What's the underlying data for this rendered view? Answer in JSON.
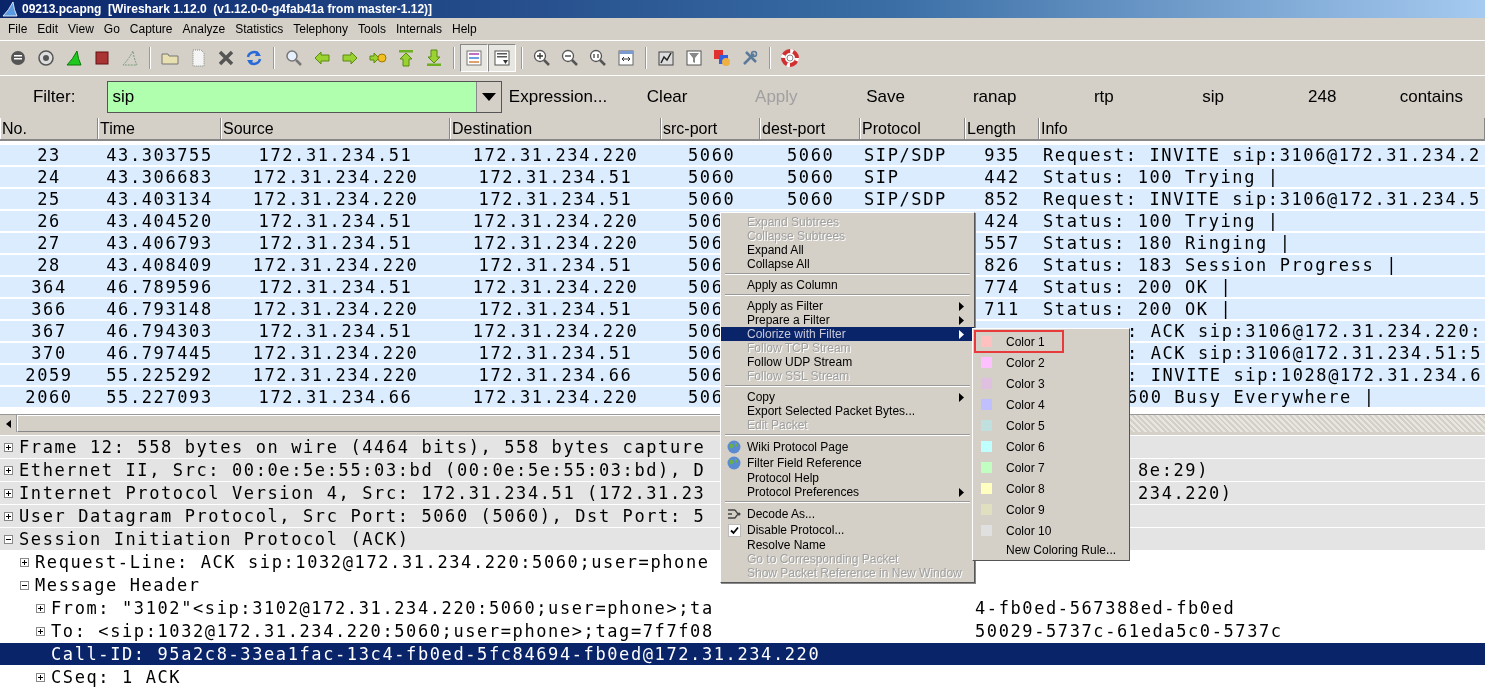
{
  "window": {
    "title": "09213.pcapng  [Wireshark 1.12.0  (v1.12.0-0-g4fab41a from master-1.12)]"
  },
  "menu_bar": [
    "File",
    "Edit",
    "View",
    "Go",
    "Capture",
    "Analyze",
    "Statistics",
    "Telephony",
    "Tools",
    "Internals",
    "Help"
  ],
  "toolbar": {
    "toggle_buttons": [
      {
        "pressed": true
      },
      {
        "pressed": true
      }
    ]
  },
  "filter_bar": {
    "label": "Filter:",
    "value": "sip",
    "buttons": [
      {
        "label": "Expression...",
        "disabled": false
      },
      {
        "label": "Clear",
        "disabled": false
      },
      {
        "label": "Apply",
        "disabled": true
      },
      {
        "label": "Save",
        "disabled": false
      },
      {
        "label": "ranap",
        "disabled": false
      },
      {
        "label": "rtp",
        "disabled": false
      },
      {
        "label": "sip",
        "disabled": false
      },
      {
        "label": "248",
        "disabled": false
      },
      {
        "label": "contains",
        "disabled": false
      }
    ]
  },
  "packet_list": {
    "columns": [
      "No.",
      "Time",
      "Source",
      "Destination",
      "src-port",
      "dest-port",
      "Protocol",
      "Length",
      "Info"
    ],
    "rows": [
      {
        "no": "23",
        "time": "43.303755",
        "source": "172.31.234.51",
        "destination": "172.31.234.220",
        "src_port": "5060",
        "dest_port": "5060",
        "protocol": "SIP/SDP",
        "length": "935",
        "info": "Request: INVITE sip:3106@172.31.234.2"
      },
      {
        "no": "24",
        "time": "43.306683",
        "source": "172.31.234.220",
        "destination": "172.31.234.51",
        "src_port": "5060",
        "dest_port": "5060",
        "protocol": "SIP",
        "length": "442",
        "info": "Status: 100 Trying |"
      },
      {
        "no": "25",
        "time": "43.403134",
        "source": "172.31.234.220",
        "destination": "172.31.234.51",
        "src_port": "5060",
        "dest_port": "5060",
        "protocol": "SIP/SDP",
        "length": "852",
        "info": "Request: INVITE sip:3106@172.31.234.5"
      },
      {
        "no": "26",
        "time": "43.404520",
        "source": "172.31.234.51",
        "destination": "172.31.234.220",
        "src_port": "506",
        "length": "424",
        "info": "Status: 100 Trying |"
      },
      {
        "no": "27",
        "time": "43.406793",
        "source": "172.31.234.51",
        "destination": "172.31.234.220",
        "src_port": "506",
        "length": "557",
        "info": "Status: 180 Ringing |"
      },
      {
        "no": "28",
        "time": "43.408409",
        "source": "172.31.234.220",
        "destination": "172.31.234.51",
        "src_port": "506",
        "length": "826",
        "info": "Status: 183 Session Progress |"
      },
      {
        "no": "364",
        "time": "46.789596",
        "source": "172.31.234.51",
        "destination": "172.31.234.220",
        "src_port": "506",
        "length": "774",
        "info": "Status: 200 OK |"
      },
      {
        "no": "366",
        "time": "46.793148",
        "source": "172.31.234.220",
        "destination": "172.31.234.51",
        "src_port": "506",
        "length": "711",
        "info": "Status: 200 OK |"
      },
      {
        "no": "367",
        "time": "46.794303",
        "source": "172.31.234.51",
        "destination": "172.31.234.220",
        "src_port": "506",
        "info": ": ACK sip:3106@172.31.234.220:"
      },
      {
        "no": "370",
        "time": "46.797445",
        "source": "172.31.234.220",
        "destination": "172.31.234.51",
        "src_port": "506",
        "info": ": ACK sip:3106@172.31.234.51:5"
      },
      {
        "no": "2059",
        "time": "55.225292",
        "source": "172.31.234.220",
        "destination": "172.31.234.66",
        "src_port": "506",
        "info": ": INVITE sip:1028@172.31.234.6"
      },
      {
        "no": "2060",
        "time": "55.227093",
        "source": "172.31.234.66",
        "destination": "172.31.234.220",
        "src_port": "506",
        "info": "600 Busy Everywhere |"
      }
    ]
  },
  "details": [
    {
      "text": "Frame 12: 558 bytes on wire (4464 bits), 558 bytes capture",
      "expanded": false,
      "selected": false
    },
    {
      "text": "Ethernet II, Src: 00:0e:5e:55:03:bd (00:0e:5e:55:03:bd), D",
      "tail": "8e:29)",
      "expanded": false,
      "selected": false
    },
    {
      "text": "Internet Protocol Version 4, Src: 172.31.234.51 (172.31.23",
      "tail": "234.220)",
      "expanded": false,
      "selected": false
    },
    {
      "text": "User Datagram Protocol, Src Port: 5060 (5060), Dst Port: 5",
      "expanded": false,
      "selected": false
    },
    {
      "text": "Session Initiation Protocol (ACK)",
      "expanded": true,
      "selected": false,
      "children": [
        {
          "text": "Request-Line: ACK sip:1032@172.31.234.220:5060;user=phone",
          "expanded": false,
          "selected": false
        },
        {
          "text": "Message Header",
          "expanded": true,
          "selected": false,
          "children": [
            {
              "text": "From: \"3102\"<sip:3102@172.31.234.220:5060;user=phone>;ta",
              "tail": "4-fb0ed-567388ed-fb0ed",
              "expanded": false,
              "selected": false
            },
            {
              "text": "To: <sip:1032@172.31.234.220:5060;user=phone>;tag=7f7f08",
              "tail": "50029-5737c-61eda5c0-5737c",
              "expanded": false,
              "selected": false
            },
            {
              "text": "Call-ID: 95a2c8-33ea1fac-13c4-fb0ed-5fc84694-fb0ed@172.31.234.220",
              "selected": true
            },
            {
              "text": "CSeq: 1 ACK",
              "expanded": false,
              "selected": false
            }
          ]
        }
      ]
    }
  ],
  "context_menu": {
    "groups": [
      {
        "items": [
          {
            "label": "Expand Subtrees",
            "kind": "plain",
            "disabled": true,
            "submenu": false,
            "selected": false
          },
          {
            "label": "Collapse Subtrees",
            "kind": "plain",
            "disabled": true,
            "submenu": false,
            "selected": false
          },
          {
            "label": "Expand All",
            "kind": "plain",
            "disabled": false,
            "submenu": false,
            "selected": false
          },
          {
            "label": "Collapse All",
            "kind": "plain",
            "disabled": false,
            "submenu": false,
            "selected": false
          }
        ]
      },
      {
        "items": [
          {
            "label": "Apply as Column",
            "kind": "plain",
            "disabled": false,
            "submenu": false,
            "selected": false
          }
        ]
      },
      {
        "items": [
          {
            "label": "Apply as Filter",
            "kind": "plain",
            "disabled": false,
            "submenu": true,
            "selected": false
          },
          {
            "label": "Prepare a Filter",
            "kind": "plain",
            "disabled": false,
            "submenu": true,
            "selected": false
          },
          {
            "label": "Colorize with Filter",
            "kind": "plain",
            "disabled": false,
            "submenu": true,
            "selected": true
          },
          {
            "label": "Follow TCP Stream",
            "kind": "plain",
            "disabled": true,
            "submenu": false,
            "selected": false
          },
          {
            "label": "Follow UDP Stream",
            "kind": "plain",
            "disabled": false,
            "submenu": false,
            "selected": false
          },
          {
            "label": "Follow SSL Stream",
            "kind": "plain",
            "disabled": true,
            "submenu": false,
            "selected": false
          }
        ]
      },
      {
        "items": [
          {
            "label": "Copy",
            "kind": "plain",
            "disabled": false,
            "submenu": true,
            "selected": false
          },
          {
            "label": "Export Selected Packet Bytes...",
            "kind": "plain",
            "disabled": false,
            "submenu": false,
            "selected": false
          },
          {
            "label": "Edit Packet",
            "kind": "plain",
            "disabled": true,
            "submenu": false,
            "selected": false
          }
        ]
      },
      {
        "items": [
          {
            "label": "Wiki Protocol Page",
            "kind": "globe",
            "disabled": false,
            "submenu": false,
            "selected": false
          },
          {
            "label": "Filter Field Reference",
            "kind": "globe",
            "disabled": false,
            "submenu": false,
            "selected": false
          },
          {
            "label": "Protocol Help",
            "kind": "plain",
            "disabled": false,
            "submenu": false,
            "selected": false
          },
          {
            "label": "Protocol Preferences",
            "kind": "plain",
            "disabled": false,
            "submenu": true,
            "selected": false
          }
        ]
      },
      {
        "items": [
          {
            "label": "Decode As...",
            "kind": "decode",
            "disabled": false,
            "submenu": false,
            "selected": false
          },
          {
            "label": "Disable Protocol...",
            "kind": "check",
            "checked": true,
            "disabled": false,
            "submenu": false,
            "selected": false
          },
          {
            "label": "Resolve Name",
            "kind": "plain",
            "disabled": false,
            "submenu": false,
            "selected": false
          },
          {
            "label": "Go to Corresponding Packet",
            "kind": "plain",
            "disabled": true,
            "submenu": false,
            "selected": false
          },
          {
            "label": "Show Packet Reference in New Window",
            "kind": "plain",
            "disabled": true,
            "submenu": false,
            "selected": false
          }
        ]
      }
    ]
  },
  "color_submenu": {
    "items": [
      {
        "label": "Color 1",
        "kind": "swatch",
        "color": "#ffc0c0",
        "selected": true
      },
      {
        "label": "Color 2",
        "kind": "swatch",
        "color": "#ffc0ff",
        "selected": false
      },
      {
        "label": "Color 3",
        "kind": "swatch",
        "color": "#e0c0e0",
        "selected": false
      },
      {
        "label": "Color 4",
        "kind": "swatch",
        "color": "#c0c0ff",
        "selected": false
      },
      {
        "label": "Color 5",
        "kind": "swatch",
        "color": "#c0e0e0",
        "selected": false
      },
      {
        "label": "Color 6",
        "kind": "swatch",
        "color": "#c0ffff",
        "selected": false
      },
      {
        "label": "Color 7",
        "kind": "swatch",
        "color": "#c0ffc0",
        "selected": false
      },
      {
        "label": "Color 8",
        "kind": "swatch",
        "color": "#ffffc0",
        "selected": false
      },
      {
        "label": "Color 9",
        "kind": "swatch",
        "color": "#e0e0c0",
        "selected": false
      },
      {
        "label": "Color 10",
        "kind": "swatch",
        "color": "#e0e0e0",
        "selected": false
      },
      {
        "label": "New Coloring Rule...",
        "kind": "plain",
        "selected": false
      }
    ]
  }
}
